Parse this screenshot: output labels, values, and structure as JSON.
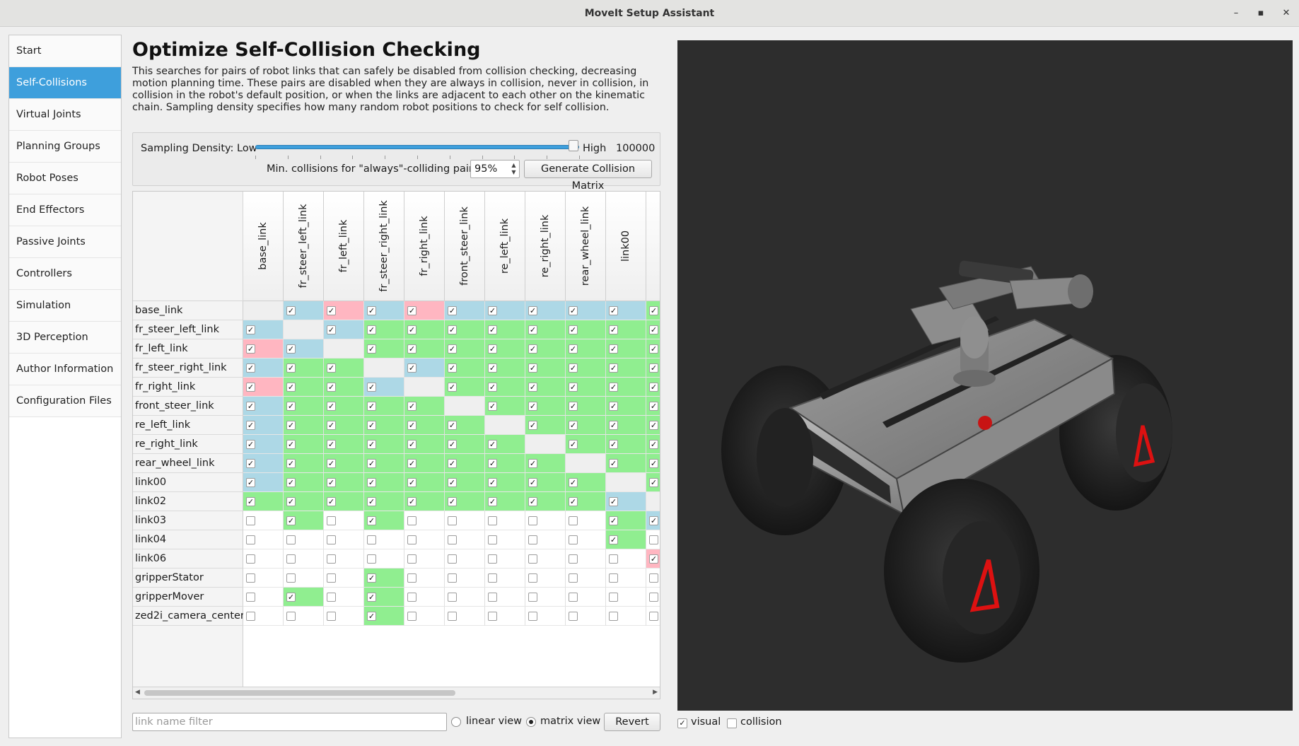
{
  "window": {
    "title": "MoveIt Setup Assistant"
  },
  "sidebar": {
    "items": [
      {
        "label": "Start",
        "active": false
      },
      {
        "label": "Self-Collisions",
        "active": true
      },
      {
        "label": "Virtual Joints",
        "active": false
      },
      {
        "label": "Planning Groups",
        "active": false
      },
      {
        "label": "Robot Poses",
        "active": false
      },
      {
        "label": "End Effectors",
        "active": false
      },
      {
        "label": "Passive Joints",
        "active": false
      },
      {
        "label": "Controllers",
        "active": false
      },
      {
        "label": "Simulation",
        "active": false
      },
      {
        "label": "3D Perception",
        "active": false
      },
      {
        "label": "Author Information",
        "active": false
      },
      {
        "label": "Configuration Files",
        "active": false
      }
    ]
  },
  "main": {
    "title": "Optimize Self-Collision Checking",
    "description": "This searches for pairs of robot links that can safely be disabled from collision checking, decreasing motion planning time. These pairs are disabled when they are always in collision, never in collision, in collision in the robot's default position, or when the links are adjacent to each other on the kinematic chain. Sampling density specifies how many random robot positions to check for self collision."
  },
  "sampling": {
    "label": "Sampling Density: Low",
    "high_label": "High",
    "value": "100000",
    "slider_fraction": 1.0,
    "min_collisions_label": "Min. collisions for \"always\"-colliding pairs:",
    "min_collisions_value": "95%",
    "generate_button": "Generate Collision Matrix"
  },
  "matrix": {
    "columns": [
      "base_link",
      "fr_steer_left_link",
      "fr_left_link",
      "fr_steer_right_link",
      "fr_right_link",
      "front_steer_link",
      "re_left_link",
      "re_right_link",
      "rear_wheel_link",
      "link00",
      ""
    ],
    "rows": [
      {
        "label": "base_link",
        "cells": [
          "d",
          "A",
          "F",
          "A",
          "F",
          "A",
          "A",
          "A",
          "A",
          "A",
          "N"
        ]
      },
      {
        "label": "fr_steer_left_link",
        "cells": [
          "A",
          "d",
          "A",
          "N",
          "N",
          "N",
          "N",
          "N",
          "N",
          "N",
          "N"
        ]
      },
      {
        "label": "fr_left_link",
        "cells": [
          "F",
          "A",
          "d",
          "N",
          "N",
          "N",
          "N",
          "N",
          "N",
          "N",
          "N"
        ]
      },
      {
        "label": "fr_steer_right_link",
        "cells": [
          "A",
          "N",
          "N",
          "d",
          "A",
          "N",
          "N",
          "N",
          "N",
          "N",
          "N"
        ]
      },
      {
        "label": "fr_right_link",
        "cells": [
          "F",
          "N",
          "N",
          "A",
          "d",
          "N",
          "N",
          "N",
          "N",
          "N",
          "N"
        ]
      },
      {
        "label": "front_steer_link",
        "cells": [
          "A",
          "N",
          "N",
          "N",
          "N",
          "d",
          "N",
          "N",
          "N",
          "N",
          "N"
        ]
      },
      {
        "label": "re_left_link",
        "cells": [
          "A",
          "N",
          "N",
          "N",
          "N",
          "N",
          "d",
          "N",
          "N",
          "N",
          "N"
        ]
      },
      {
        "label": "re_right_link",
        "cells": [
          "A",
          "N",
          "N",
          "N",
          "N",
          "N",
          "N",
          "d",
          "N",
          "N",
          "N"
        ]
      },
      {
        "label": "rear_wheel_link",
        "cells": [
          "A",
          "N",
          "N",
          "N",
          "N",
          "N",
          "N",
          "N",
          "d",
          "N",
          "N"
        ]
      },
      {
        "label": "link00",
        "cells": [
          "A",
          "N",
          "N",
          "N",
          "N",
          "N",
          "N",
          "N",
          "N",
          "d",
          "N"
        ]
      },
      {
        "label": "link02",
        "cells": [
          "N",
          "N",
          "N",
          "N",
          "N",
          "N",
          "N",
          "N",
          "N",
          "A",
          "d"
        ]
      },
      {
        "label": "link03",
        "cells": [
          "e",
          "N",
          "e",
          "N",
          "e",
          "e",
          "e",
          "e",
          "e",
          "N",
          "A"
        ]
      },
      {
        "label": "link04",
        "cells": [
          "e",
          "e",
          "e",
          "e",
          "e",
          "e",
          "e",
          "e",
          "e",
          "N",
          "e"
        ]
      },
      {
        "label": "link06",
        "cells": [
          "e",
          "e",
          "e",
          "e",
          "e",
          "e",
          "e",
          "e",
          "e",
          "e",
          "F"
        ]
      },
      {
        "label": "gripperStator",
        "cells": [
          "e",
          "e",
          "e",
          "N",
          "e",
          "e",
          "e",
          "e",
          "e",
          "e",
          "e"
        ]
      },
      {
        "label": "gripperMover",
        "cells": [
          "e",
          "N",
          "e",
          "N",
          "e",
          "e",
          "e",
          "e",
          "e",
          "e",
          "e"
        ]
      },
      {
        "label": "zed2i_camera_center",
        "cells": [
          "e",
          "e",
          "e",
          "N",
          "e",
          "e",
          "e",
          "e",
          "e",
          "e",
          "e"
        ]
      }
    ]
  },
  "bottom": {
    "filter_placeholder": "link name filter",
    "linear_view": "linear view",
    "matrix_view": "matrix view",
    "selected_view": "matrix view",
    "revert_button": "Revert"
  },
  "viewer": {
    "visual_label": "visual",
    "visual_checked": true,
    "collision_label": "collision",
    "collision_checked": false
  },
  "colors": {
    "accent": "#3e9fdc",
    "adjacent": "#add8e6",
    "default": "#ffb6c1",
    "never": "#90ee90"
  }
}
